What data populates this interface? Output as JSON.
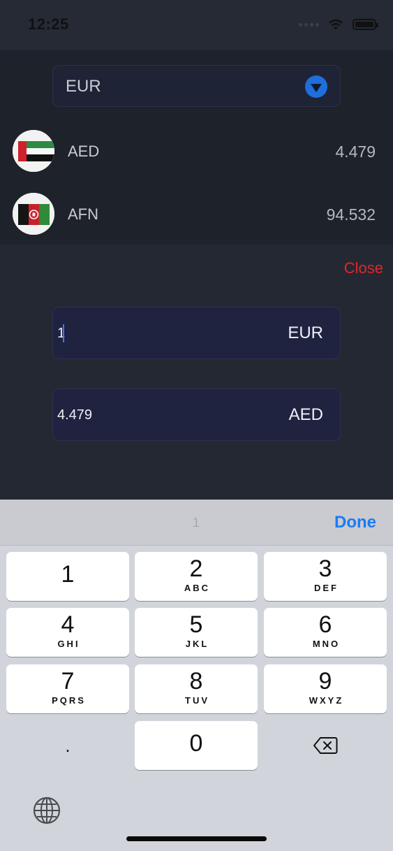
{
  "status_bar": {
    "time": "12:25",
    "icons": [
      "signal-icon",
      "wifi-icon",
      "battery-icon"
    ]
  },
  "currency_select": {
    "value": "EUR",
    "icon": "chevron-down-icon"
  },
  "rates": [
    {
      "code": "AED",
      "rate": "4.479",
      "flag": "uae-flag-icon"
    },
    {
      "code": "AFN",
      "rate": "94.532",
      "flag": "afghanistan-flag-icon"
    }
  ],
  "close_label": "Close",
  "converter": {
    "from": {
      "value": "1",
      "code": "EUR"
    },
    "to": {
      "value": "4.479",
      "code": "AED"
    }
  },
  "keyboard": {
    "preview": "1",
    "done_label": "Done",
    "keys": [
      {
        "num": "1",
        "letters": ""
      },
      {
        "num": "2",
        "letters": "ABC"
      },
      {
        "num": "3",
        "letters": "DEF"
      },
      {
        "num": "4",
        "letters": "GHI"
      },
      {
        "num": "5",
        "letters": "JKL"
      },
      {
        "num": "6",
        "letters": "MNO"
      },
      {
        "num": "7",
        "letters": "PQRS"
      },
      {
        "num": "8",
        "letters": "TUV"
      },
      {
        "num": "9",
        "letters": "WXYZ"
      },
      {
        "num": "0",
        "letters": ""
      }
    ],
    "decimal_label": ".",
    "backspace_icon": "backspace-icon",
    "globe_icon": "globe-icon"
  },
  "colors": {
    "background": "#242833",
    "accent_blue": "#1e6fd9",
    "close_red": "#e0262c",
    "done_blue": "#1a7cf3",
    "field_bg": "#1f2340"
  }
}
